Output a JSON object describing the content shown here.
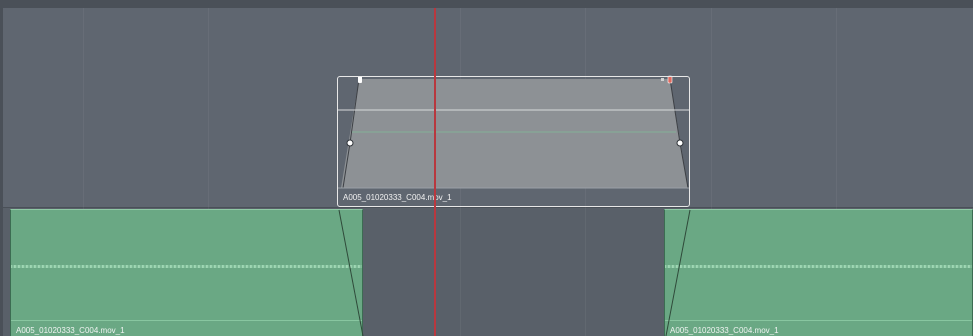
{
  "timeline": {
    "playhead_color": "#b8383f",
    "video_track_color": "#5f6670",
    "audio_clip_color": "#6aa884"
  },
  "clips": {
    "left_audio_clip": {
      "label": "A005_01020333_C004.mov_1"
    },
    "right_audio_clip": {
      "label": "A005_01020333_C004.mov_1"
    },
    "transition_clip": {
      "label": "A005_01020333_C004.mov_1"
    }
  },
  "icons": {
    "keyframe_handle": "keyframe-handle-icon",
    "fade_handle": "fade-handle-icon",
    "transition_marker": "transition-marker-icon"
  }
}
